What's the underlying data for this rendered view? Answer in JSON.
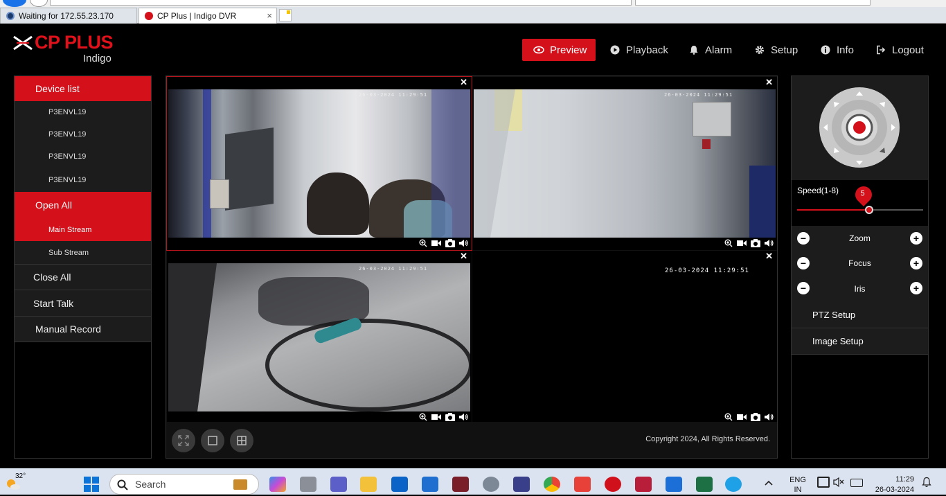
{
  "browser": {
    "tabs": [
      {
        "label": "Waiting for 172.55.23.170"
      },
      {
        "label": "CP Plus | Indigo DVR",
        "close": "×"
      }
    ]
  },
  "header": {
    "logo_text": "CP PLUS",
    "logo_sub": "Indigo",
    "nav": [
      {
        "label": "Preview",
        "icon": "eye-icon",
        "active": true
      },
      {
        "label": "Playback",
        "icon": "play-circle-icon"
      },
      {
        "label": "Alarm",
        "icon": "bell-icon"
      },
      {
        "label": "Setup",
        "icon": "gear-icon"
      },
      {
        "label": "Info",
        "icon": "info-icon"
      },
      {
        "label": "Logout",
        "icon": "logout-icon"
      }
    ]
  },
  "sidebar": {
    "device_list": "Device list",
    "devices": [
      "P3ENVL19",
      "P3ENVL19",
      "P3ENVL19",
      "P3ENVL19"
    ],
    "open_all": "Open All",
    "main_stream": "Main Stream",
    "sub_stream": "Sub Stream",
    "close_all": "Close All",
    "start_talk": "Start Talk",
    "manual_record": "Manual Record"
  },
  "video": {
    "cells": [
      {
        "timestamp": "26-03-2024 11:29:51",
        "close": "✕"
      },
      {
        "timestamp": "26-03-2024 11:29:51",
        "close": "✕"
      },
      {
        "timestamp": "26-03-2024 11:29:51",
        "close": "✕"
      },
      {
        "timestamp": "26-03-2024 11:29:51",
        "close": "✕"
      }
    ],
    "copyright": "Copyright 2024, All Rights Reserved."
  },
  "ptz": {
    "speed_label": "Speed(1-8)",
    "speed_value": "5",
    "speed_fraction": 0.57,
    "zoom": "Zoom",
    "focus": "Focus",
    "iris": "Iris",
    "minus": "−",
    "plus": "+",
    "ptz_setup": "PTZ Setup",
    "image_setup": "Image Setup"
  },
  "taskbar": {
    "temperature": "32°",
    "search": "Search",
    "lang1": "ENG",
    "lang2": "IN",
    "time": "11:29",
    "date": "26-03-2024"
  },
  "colors": {
    "accent_red": "#d4101b",
    "panel_dark": "#1c1c1c"
  }
}
